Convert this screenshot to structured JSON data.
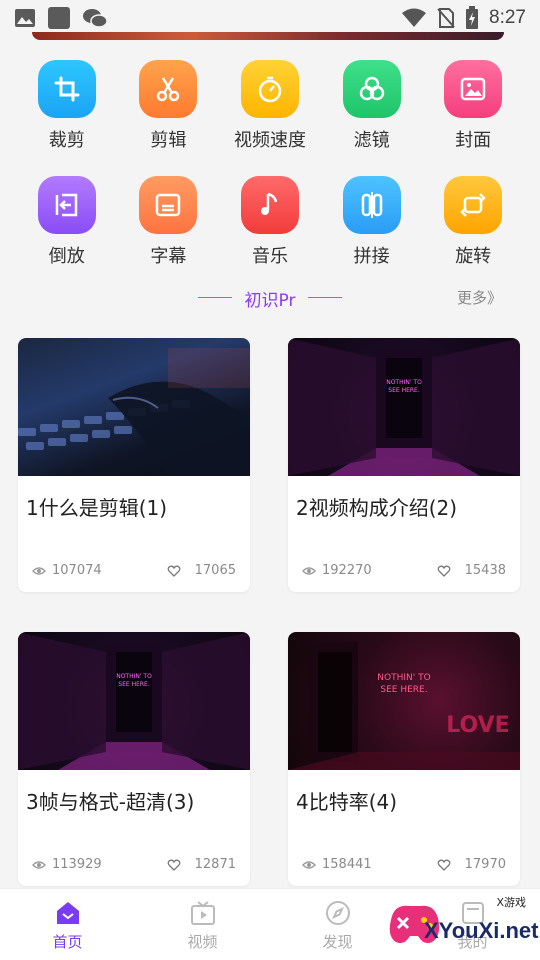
{
  "status_bar": {
    "time": "8:27",
    "icons": [
      "gallery-icon",
      "app-icon",
      "wechat-icon",
      "wifi-icon",
      "no-sim-icon",
      "battery-icon"
    ]
  },
  "tools": [
    {
      "label": "裁剪",
      "icon": "crop-icon",
      "color_from": "#2ec6ff",
      "color_to": "#1aa4f5"
    },
    {
      "label": "剪辑",
      "icon": "scissors-icon",
      "color_from": "#ffa34d",
      "color_to": "#ff7a2f"
    },
    {
      "label": "视频速度",
      "icon": "stopwatch-icon",
      "color_from": "#ffd335",
      "color_to": "#ffb400"
    },
    {
      "label": "滤镜",
      "icon": "filter-icon",
      "color_from": "#3ee08a",
      "color_to": "#1fc46a"
    },
    {
      "label": "封面",
      "icon": "image-icon",
      "color_from": "#ff6fa0",
      "color_to": "#f53e7d"
    },
    {
      "label": "倒放",
      "icon": "reverse-icon",
      "color_from": "#b27bff",
      "color_to": "#8a4cf5"
    },
    {
      "label": "字幕",
      "icon": "subtitle-icon",
      "color_from": "#ff9c62",
      "color_to": "#ff7340"
    },
    {
      "label": "音乐",
      "icon": "music-icon",
      "color_from": "#ff6a6a",
      "color_to": "#f23b3b"
    },
    {
      "label": "拼接",
      "icon": "splice-icon",
      "color_from": "#4ec3ff",
      "color_to": "#2a9cf5"
    },
    {
      "label": "旋转",
      "icon": "rotate-icon",
      "color_from": "#ffc83d",
      "color_to": "#ffa400"
    }
  ],
  "section": {
    "title": "初识Pr",
    "more": "更多》"
  },
  "cards": [
    {
      "title": "1什么是剪辑(1)",
      "views": "107074",
      "likes": "17065",
      "thumb": "keyboard"
    },
    {
      "title": "2视频构成介绍(2)",
      "views": "192270",
      "likes": "15438",
      "thumb": "neon"
    },
    {
      "title": "3帧与格式-超清(3)",
      "views": "113929",
      "likes": "12871",
      "thumb": "neon"
    },
    {
      "title": "4比特率(4)",
      "views": "158441",
      "likes": "17970",
      "thumb": "red"
    }
  ],
  "bottom_nav": [
    {
      "label": "首页",
      "icon": "home-icon",
      "active": true
    },
    {
      "label": "视频",
      "icon": "video-icon",
      "active": false
    },
    {
      "label": "发现",
      "icon": "compass-icon",
      "active": false
    },
    {
      "label": "我的",
      "icon": "profile-icon",
      "active": false
    }
  ],
  "watermark": {
    "text": "XYouXi.net",
    "small": "X游戏"
  },
  "colors": {
    "accent": "#8a3cf0",
    "meta": "#8a8a8a"
  }
}
